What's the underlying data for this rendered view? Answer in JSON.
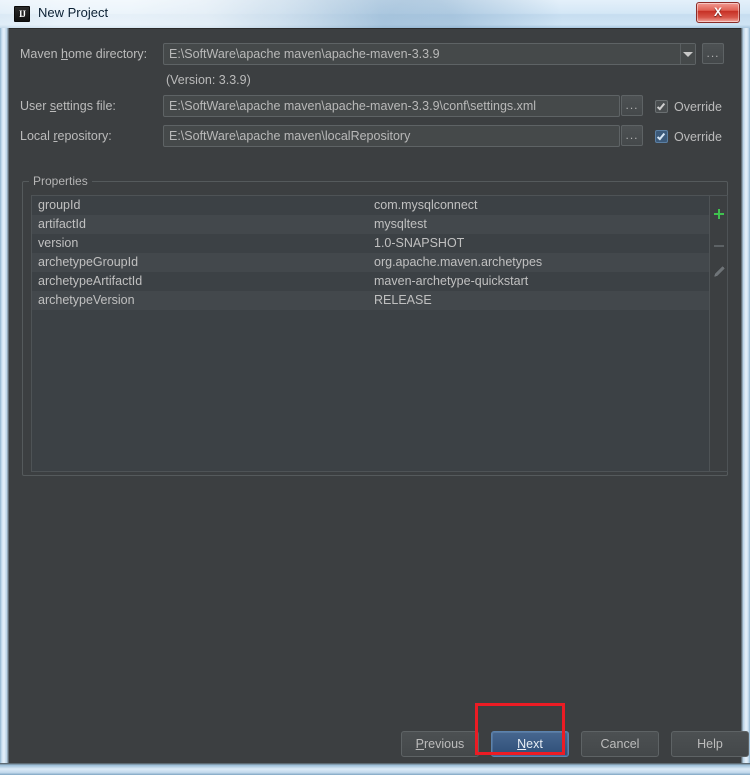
{
  "window": {
    "title": "New Project",
    "app_icon": "intellij-idea-icon",
    "close_label": "X"
  },
  "form": {
    "maven_home": {
      "label_pre": "Maven ",
      "label_mnemonic": "h",
      "label_post": "ome directory:",
      "value": "E:\\SoftWare\\apache maven\\apache-maven-3.3.9",
      "browse_label": "...",
      "version_note": "(Version: 3.3.9)"
    },
    "user_settings": {
      "label_pre": "User ",
      "label_mnemonic": "s",
      "label_post": "ettings file:",
      "value": "E:\\SoftWare\\apache maven\\apache-maven-3.3.9\\conf\\settings.xml",
      "browse_label": "...",
      "override_label": "Override",
      "override_checked": true
    },
    "local_repository": {
      "label_pre": "Local ",
      "label_mnemonic": "r",
      "label_post": "epository:",
      "value": "E:\\SoftWare\\apache maven\\localRepository",
      "browse_label": "...",
      "override_label": "Override",
      "override_checked": true
    }
  },
  "properties_panel": {
    "title": "Properties",
    "rows": [
      {
        "key": "groupId",
        "value": "com.mysqlconnect"
      },
      {
        "key": "artifactId",
        "value": "mysqltest"
      },
      {
        "key": "version",
        "value": "1.0-SNAPSHOT"
      },
      {
        "key": "archetypeGroupId",
        "value": "org.apache.maven.archetypes"
      },
      {
        "key": "archetypeArtifactId",
        "value": "maven-archetype-quickstart"
      },
      {
        "key": "archetypeVersion",
        "value": "RELEASE"
      }
    ],
    "toolbar": {
      "add": "add-icon",
      "remove": "remove-icon",
      "edit": "edit-pencil-icon"
    }
  },
  "footer": {
    "previous": {
      "pre": "",
      "mnemonic": "P",
      "post": "revious"
    },
    "next": {
      "pre": "",
      "mnemonic": "N",
      "post": "ext"
    },
    "cancel": {
      "pre": "Cancel",
      "mnemonic": "",
      "post": ""
    },
    "help": {
      "pre": "Help",
      "mnemonic": "",
      "post": ""
    }
  },
  "annotation": {
    "highlight_color": "#ec1c24",
    "target": "next-button"
  }
}
